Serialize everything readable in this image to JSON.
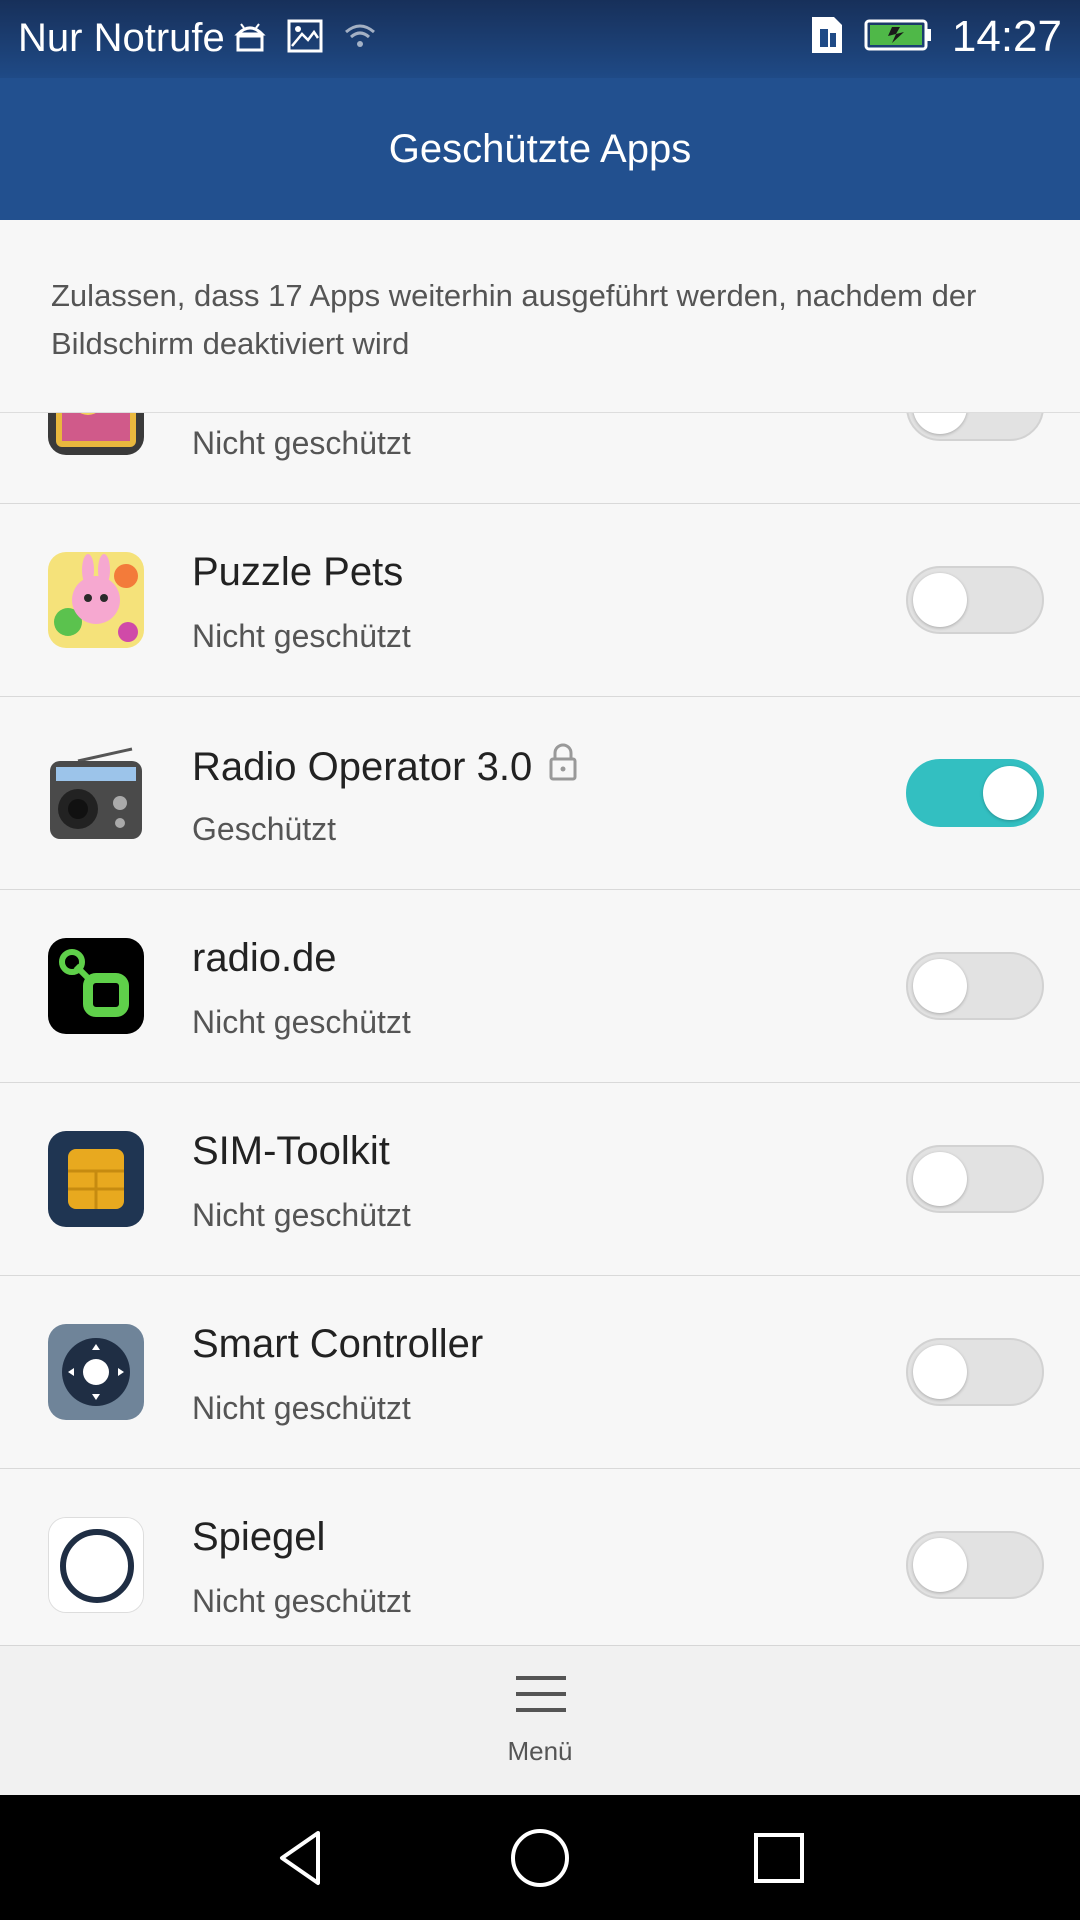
{
  "status_bar": {
    "carrier": "Nur Notrufe",
    "time": "14:27",
    "icons": [
      "android-icon",
      "image-icon",
      "wifi-icon",
      "sim-card-icon",
      "battery-charging-icon"
    ]
  },
  "app_bar": {
    "title": "Geschützte Apps"
  },
  "description": "Zulassen, dass 17 Apps weiterhin ausgeführt werden, nachdem der Bildschirm deaktiviert wird",
  "apps": [
    {
      "name": "",
      "status": "Nicht geschützt",
      "protected": false,
      "icon": "gallery-app-icon"
    },
    {
      "name": "Puzzle Pets",
      "status": "Nicht geschützt",
      "protected": false,
      "icon": "puzzle-pets-icon"
    },
    {
      "name": "Radio Operator 3.0",
      "status": "Geschützt",
      "protected": true,
      "locked": true,
      "icon": "radio-icon"
    },
    {
      "name": "radio.de",
      "status": "Nicht geschützt",
      "protected": false,
      "icon": "radio-de-icon"
    },
    {
      "name": "SIM-Toolkit",
      "status": "Nicht geschützt",
      "protected": false,
      "icon": "sim-toolkit-icon"
    },
    {
      "name": "Smart Controller",
      "status": "Nicht geschützt",
      "protected": false,
      "icon": "remote-control-icon"
    },
    {
      "name": "Spiegel",
      "status": "Nicht geschützt",
      "protected": false,
      "icon": "mirror-icon"
    }
  ],
  "bottom_menu": {
    "label": "Menü"
  },
  "nav_bar": [
    "back-icon",
    "home-icon",
    "recents-icon"
  ],
  "colors": {
    "app_bar": "#22508f",
    "toggle_on": "#33bfc1",
    "toggle_off": "#e2e2e2"
  }
}
